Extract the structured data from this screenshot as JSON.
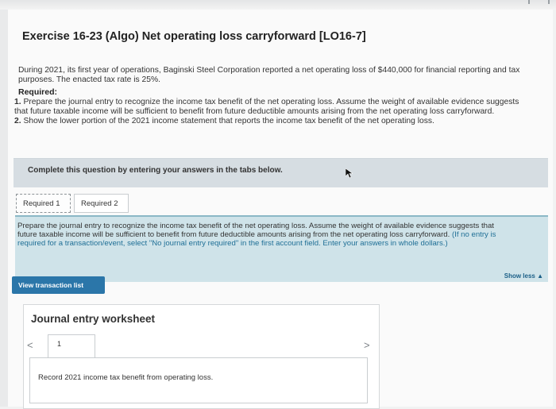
{
  "exercise": {
    "title": "Exercise 16-23 (Algo) Net operating loss carryforward [LO16-7]",
    "intro": "During 2021, its first year of operations, Baginski Steel Corporation reported a net operating loss of $440,000 for financial reporting and tax purposes. The enacted tax rate is 25%.",
    "required_heading": "Required:",
    "required": [
      {
        "num": "1.",
        "text": "Prepare the journal entry to recognize the income tax benefit of the net operating loss. Assume the weight of available evidence suggests that future taxable income will be sufficient to benefit from future deductible amounts arising from the net operating loss carryforward."
      },
      {
        "num": "2.",
        "text": "Show the lower portion of the 2021 income statement that reports the income tax benefit of the net operating loss."
      }
    ]
  },
  "instructions": {
    "complete_text": "Complete this question by entering your answers in the tabs below."
  },
  "tabs": [
    {
      "label": "Required 1"
    },
    {
      "label": "Required 2"
    }
  ],
  "panel": {
    "text": "Prepare the journal entry to recognize the income tax benefit of the net operating loss. Assume the weight of available evidence suggests that future taxable income will be sufficient to benefit from future deductible amounts arising from the net operating loss carryforward.",
    "hint": "(If no entry is required for a transaction/event, select \"No journal entry required\" in the first account field. Enter your answers in whole dollars.)",
    "show_less": "Show less ▲"
  },
  "buttons": {
    "view_transaction_list": "View transaction list"
  },
  "worksheet": {
    "title": "Journal entry worksheet",
    "prev": "<",
    "next": ">",
    "page_number": "1",
    "record_text": "Record 2021 income tax benefit from operating loss."
  },
  "colors": {
    "primary_button": "#2b76a9",
    "panel_bg": "#cfe3e9",
    "instruction_bar": "#d6dde2"
  }
}
